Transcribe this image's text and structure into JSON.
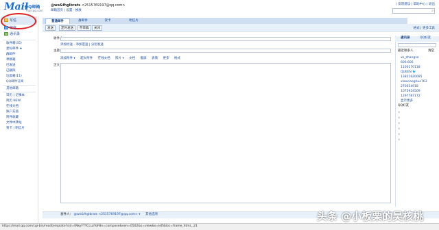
{
  "header": {
    "logo_mail": "Mail",
    "logo_qq": "QQ邮箱",
    "logo_domain": "mail.qq.com",
    "user_name": "@we&fhglbrats",
    "user_email": "<2515769197@qq.com>",
    "user_links": "邮箱首页 | 设置 - 换肤",
    "top_links": "| 反馈建议 | 帮助中心 | 退出"
  },
  "leftnav": {
    "compose": "写信",
    "inbox": "收信",
    "contacts": "通讯录",
    "folders": [
      {
        "label": "收件箱(35)"
      },
      {
        "label": "星标邮件 ★"
      },
      {
        "label": "群邮件"
      },
      {
        "label": "草稿箱"
      },
      {
        "label": "已发送"
      },
      {
        "label": "已删除"
      },
      {
        "label": "垃圾箱(11)"
      },
      {
        "label": "QQ邮件订阅"
      }
    ],
    "other": "其他邮箱",
    "extras": [
      {
        "label": "日历 | 记事本"
      },
      {
        "label": "简历 NEW"
      },
      {
        "label": "在线文档"
      },
      {
        "label": "账户充值"
      },
      {
        "label": "附件收藏"
      },
      {
        "label": "文件中转站"
      },
      {
        "label": "贺卡 | 明信片"
      }
    ]
  },
  "tabs": [
    "普通邮件",
    "群邮件",
    "贺卡",
    "明信片"
  ],
  "toolbar": {
    "send": "发送",
    "schedule": "定时发送",
    "save_draft": "存草稿",
    "close": "关闭",
    "right_info": "格式 | 更多工具"
  },
  "form": {
    "to_label": "收件人",
    "add_links": "添加抄送 - 添加密送 | 分别发送",
    "subject_label": "主题",
    "format_items": [
      "添加附件 ▾",
      "超大附件",
      "在线文档",
      "照片 ▾",
      "文档",
      "截屏",
      "表情",
      "更多",
      "格式"
    ],
    "body_label": "正文"
  },
  "footer": {
    "sender_label": "发件人：",
    "sender_value": "@we&fhglbrats <2515769197@qq.com> ▾",
    "other_options": "其他选项"
  },
  "rightpanel": {
    "tab_contacts": "通讯录",
    "tab_qq": "QQ好友",
    "recent_head": "最近联系人",
    "recent_more": "清空",
    "contacts": [
      {
        "label": "xk_zhangxo"
      },
      {
        "label": "606.606"
      },
      {
        "label": "1100170118"
      },
      {
        "label": "QUEEN 🐦"
      },
      {
        "label": "13821620095"
      },
      {
        "label": "xiaoxiaoghuo763"
      },
      {
        "label": "270034918"
      },
      {
        "label": "1072924509"
      },
      {
        "label": "1297787172"
      },
      {
        "label": "显示更多"
      }
    ],
    "qq_head": "QQ好友"
  },
  "statusbar": {
    "url": "https://mail.qq.com/cgi-bin/readtemplate?sid=tNkyFTYCcuzYoF8n=compose&ven=0502&s=view&s=left&loc=frame_html,,,21"
  },
  "watermark": "头条 @小板栗的昊核桃",
  "colors": {
    "accent": "#1d6fce",
    "link": "#1f4e9d",
    "highlight_circle": "#e02020"
  }
}
